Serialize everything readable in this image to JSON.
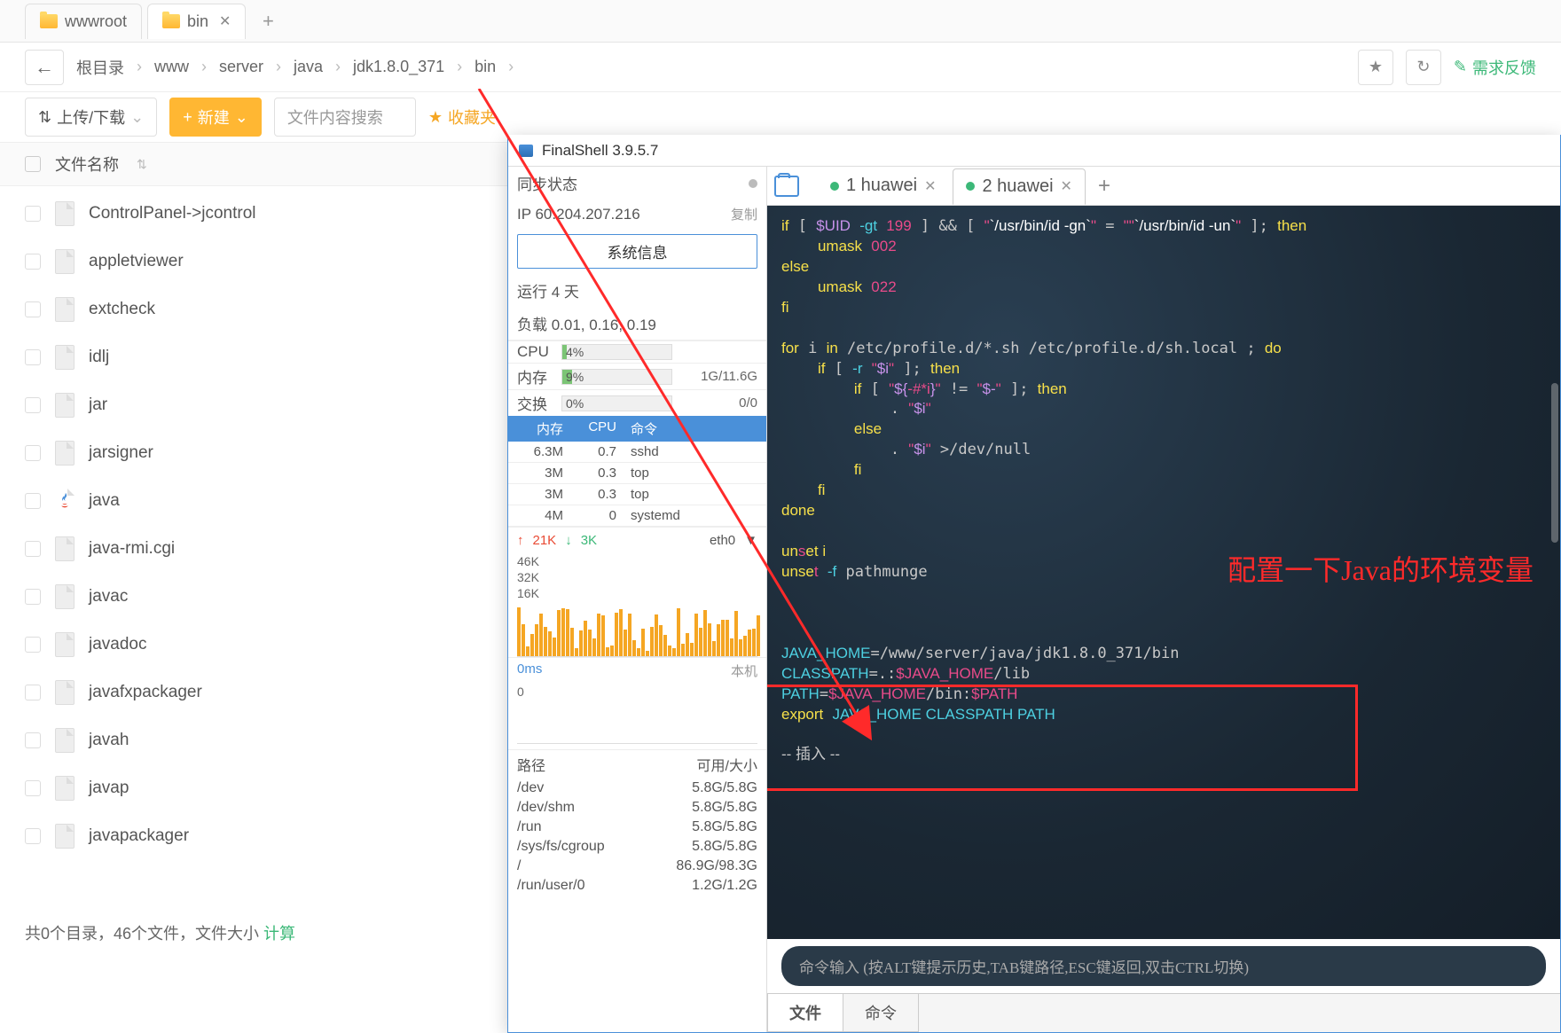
{
  "tabs": [
    {
      "label": "wwwroot",
      "active": false
    },
    {
      "label": "bin",
      "active": true
    }
  ],
  "breadcrumb": [
    "根目录",
    "www",
    "server",
    "java",
    "jdk1.8.0_371",
    "bin"
  ],
  "feedback": "需求反馈",
  "toolbar": {
    "upload": "上传/下载",
    "new": "新建",
    "search_placeholder": "文件内容搜索",
    "favorites": "收藏夹"
  },
  "file_header": "文件名称",
  "files": [
    {
      "name": "ControlPanel->jcontrol",
      "type": "file"
    },
    {
      "name": "appletviewer",
      "type": "file"
    },
    {
      "name": "extcheck",
      "type": "file"
    },
    {
      "name": "idlj",
      "type": "file"
    },
    {
      "name": "jar",
      "type": "file"
    },
    {
      "name": "jarsigner",
      "type": "file"
    },
    {
      "name": "java",
      "type": "java"
    },
    {
      "name": "java-rmi.cgi",
      "type": "file"
    },
    {
      "name": "javac",
      "type": "file"
    },
    {
      "name": "javadoc",
      "type": "file"
    },
    {
      "name": "javafxpackager",
      "type": "file"
    },
    {
      "name": "javah",
      "type": "file"
    },
    {
      "name": "javap",
      "type": "file"
    },
    {
      "name": "javapackager",
      "type": "file"
    }
  ],
  "status_text": "共0个目录，46个文件，文件大小",
  "status_calc": "计算",
  "finalshell": {
    "title": "FinalShell 3.9.5.7",
    "sync_label": "同步状态",
    "ip": "IP 60.204.207.216",
    "copy": "复制",
    "sysinfo_btn": "系统信息",
    "uptime": "运行 4 天",
    "load": "负载 0.01, 0.16, 0.19",
    "cpu_label": "CPU",
    "cpu_val": "4%",
    "mem_label": "内存",
    "mem_val": "9%",
    "mem_detail": "1G/11.6G",
    "swap_label": "交换",
    "swap_val": "0%",
    "swap_detail": "0/0",
    "proc_headers": [
      "内存",
      "CPU",
      "命令"
    ],
    "procs": [
      {
        "mem": "6.3M",
        "cpu": "0.7",
        "cmd": "sshd"
      },
      {
        "mem": "3M",
        "cpu": "0.3",
        "cmd": "top"
      },
      {
        "mem": "3M",
        "cpu": "0.3",
        "cmd": "top"
      },
      {
        "mem": "4M",
        "cpu": "0",
        "cmd": "systemd"
      }
    ],
    "net_up": "21K",
    "net_down": "3K",
    "net_if": "eth0",
    "net_y": [
      "46K",
      "32K",
      "16K"
    ],
    "ping": "0ms",
    "ping_host": "本机",
    "ping_y": "0",
    "disk_headers": [
      "路径",
      "可用/大小"
    ],
    "disks": [
      {
        "path": "/dev",
        "size": "5.8G/5.8G"
      },
      {
        "path": "/dev/shm",
        "size": "5.8G/5.8G"
      },
      {
        "path": "/run",
        "size": "5.8G/5.8G"
      },
      {
        "path": "/sys/fs/cgroup",
        "size": "5.8G/5.8G"
      },
      {
        "path": "/",
        "size": "86.9G/98.3G"
      },
      {
        "path": "/run/user/0",
        "size": "1.2G/1.2G"
      }
    ],
    "term_tabs": [
      {
        "label": "1 huawei",
        "active": false
      },
      {
        "label": "2 huawei",
        "active": true
      }
    ],
    "overlay_text": "配置一下Java的环境变量",
    "insert_mode": "-- 插入 --",
    "cmd_placeholder": "命令输入 (按ALT键提示历史,TAB键路径,ESC键返回,双击CTRL切换)",
    "bottom_tabs": [
      "文件",
      "命令"
    ]
  }
}
